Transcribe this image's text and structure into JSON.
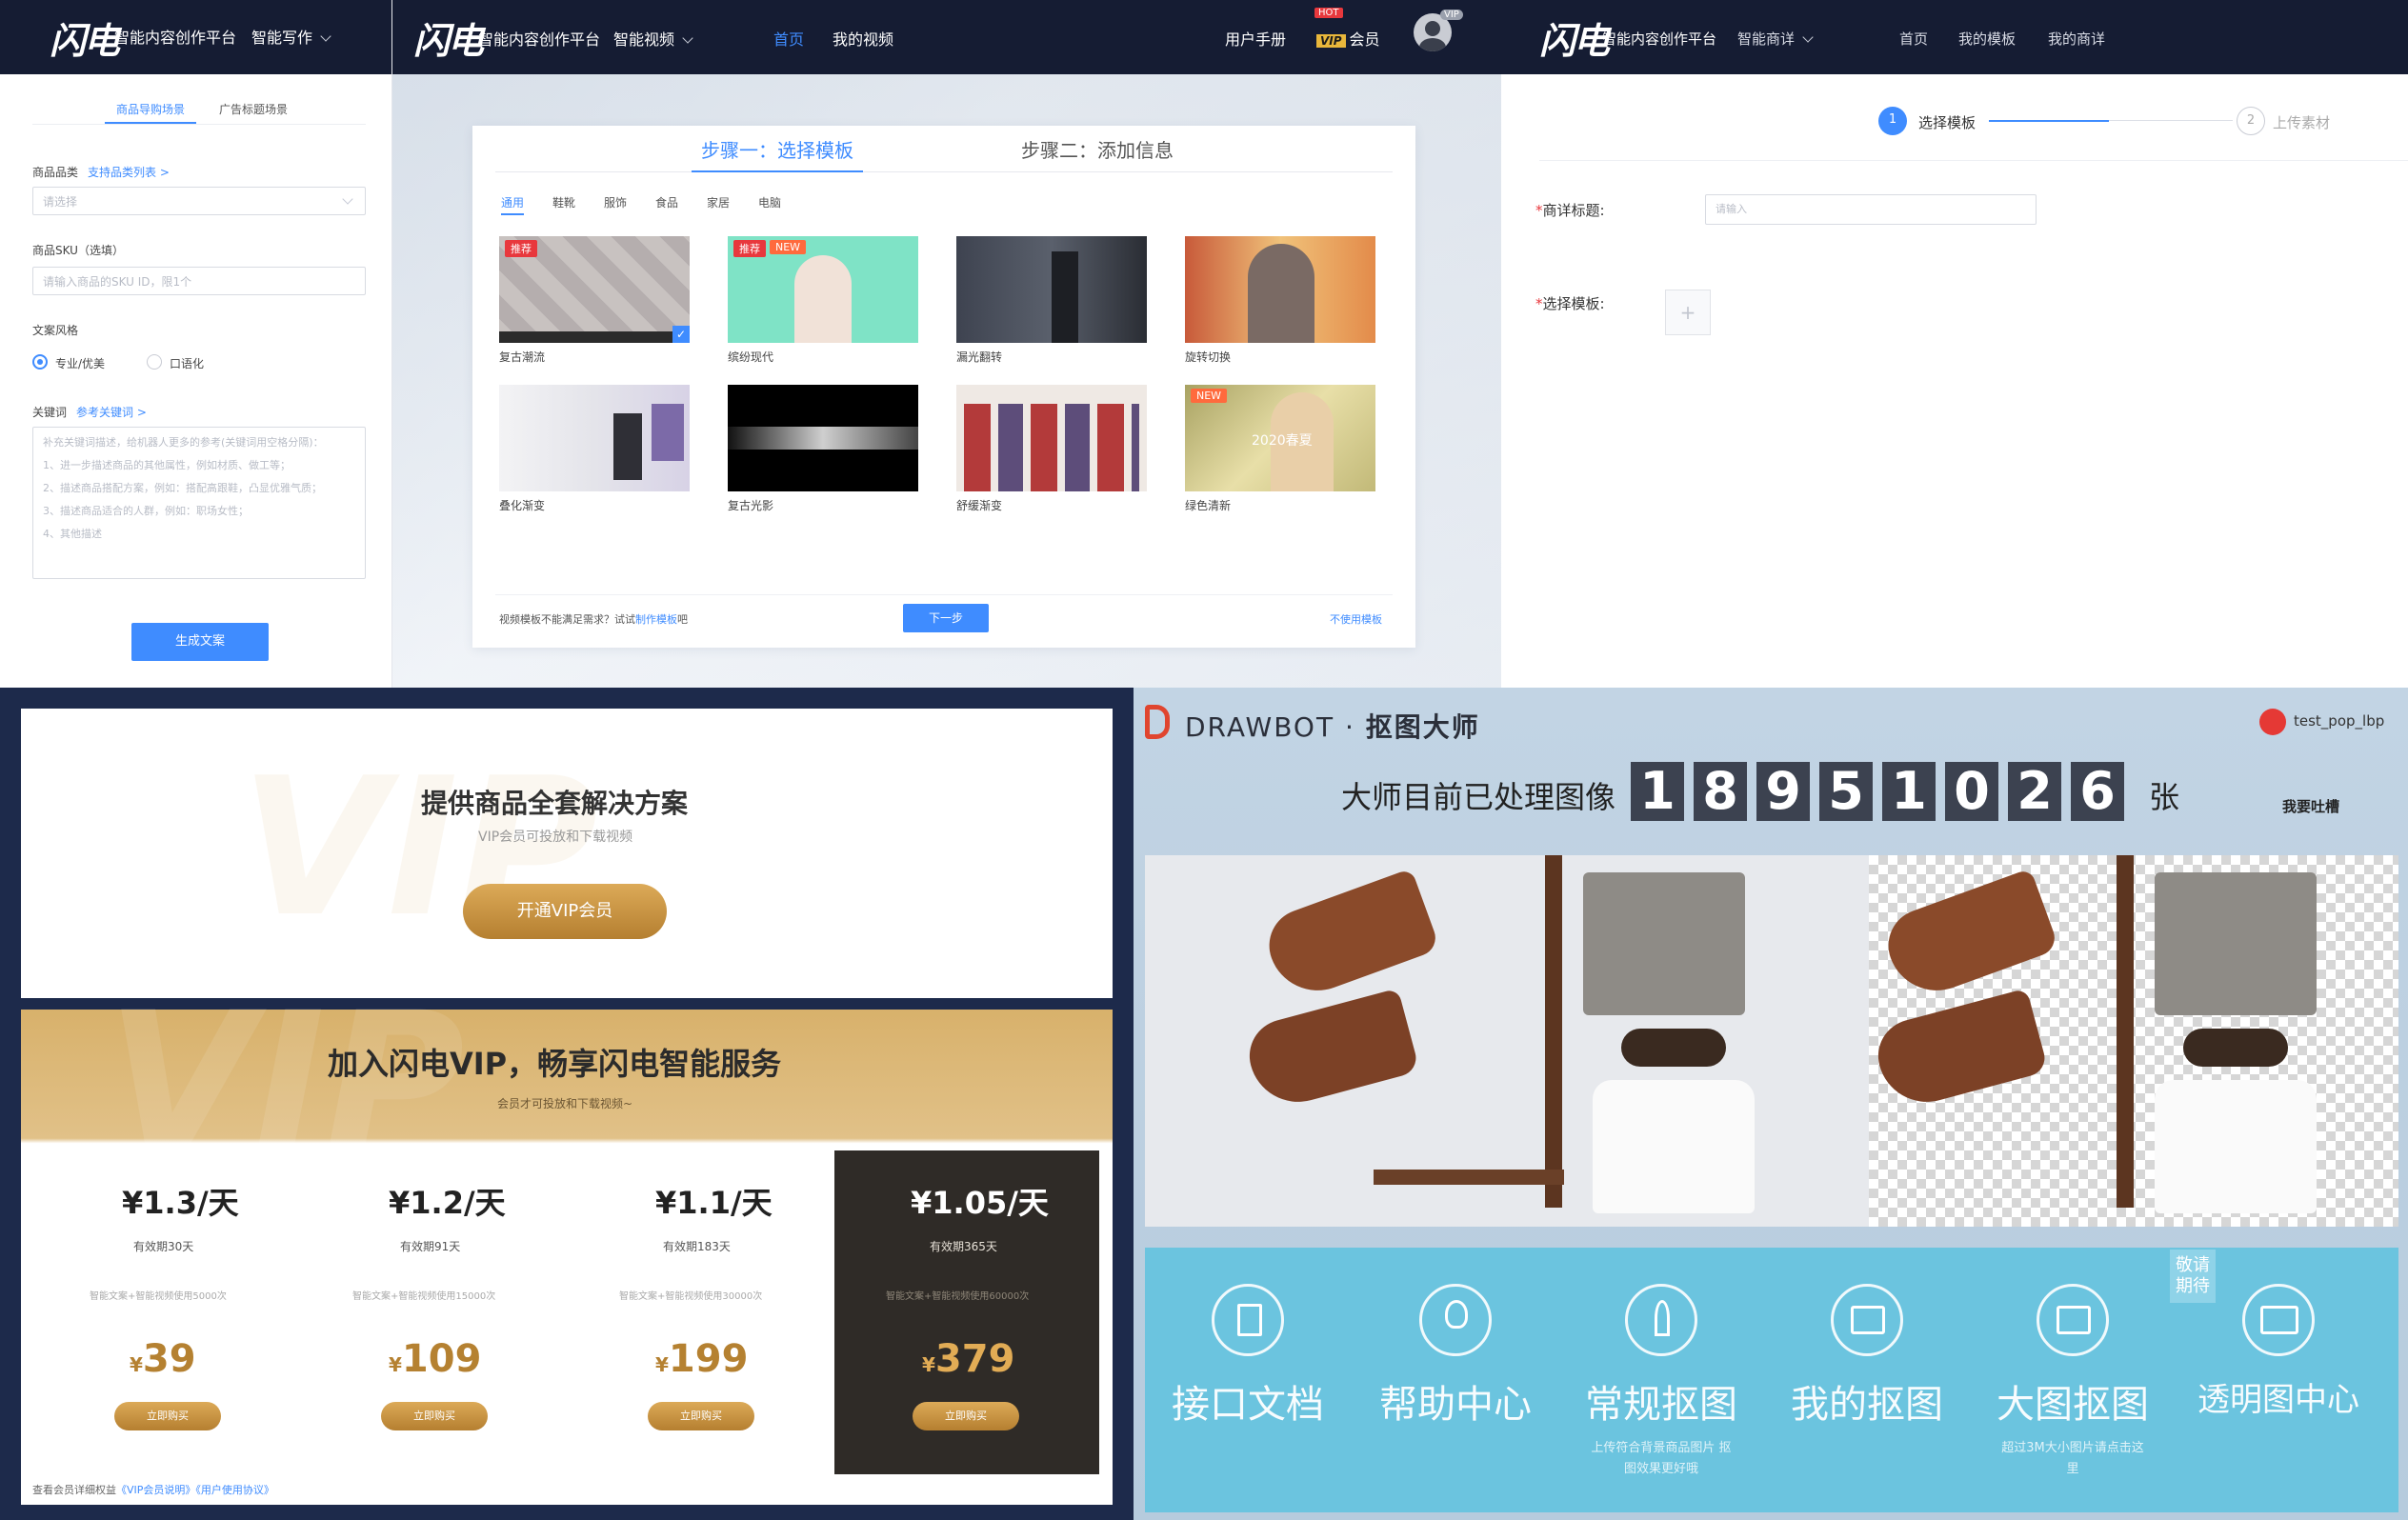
{
  "panel_writing": {
    "nav": {
      "logo": "闪电",
      "platform": "智能内容创作平台",
      "module": "智能写作"
    },
    "tabs": [
      "商品导购场景",
      "广告标题场景"
    ],
    "category": {
      "label": "商品品类",
      "link": "支持品类列表 >",
      "placeholder": "请选择"
    },
    "sku": {
      "label": "商品SKU（选填）",
      "placeholder": "请输入商品的SKU ID，限1个"
    },
    "style": {
      "label": "文案风格",
      "options": [
        "专业/优美",
        "口语化"
      ]
    },
    "keywords": {
      "label": "关键词",
      "link": "参考关键词 >",
      "hint": [
        "补充关键词描述，给机器人更多的参考(关键词用空格分隔)：",
        "1、进一步描述商品的其他属性，例如材质、做工等；",
        "2、描述商品搭配方案，例如：搭配高跟鞋，凸显优雅气质；",
        "3、描述商品适合的人群，例如：职场女性；",
        "4、其他描述"
      ]
    },
    "generate_button": "生成文案"
  },
  "panel_video": {
    "nav": {
      "logo": "闪电",
      "platform": "智能内容创作平台",
      "module": "智能视频",
      "home": "首页",
      "my_videos": "我的视频",
      "manual": "用户手册",
      "hot": "HOT",
      "vip_badge": "VIP",
      "member": "会员",
      "avatar_badge": "VIP"
    },
    "step1": "步骤一：选择模板",
    "step2": "步骤二：添加信息",
    "categories": [
      "通用",
      "鞋靴",
      "服饰",
      "食品",
      "家居",
      "电脑"
    ],
    "templates": [
      {
        "name": "复古潮流",
        "tag": "推荐"
      },
      {
        "name": "缤纷现代",
        "tag": "推荐",
        "tag2": "NEW"
      },
      {
        "name": "漏光翻转"
      },
      {
        "name": "旋转切换"
      },
      {
        "name": "叠化渐变"
      },
      {
        "name": "复古光影"
      },
      {
        "name": "舒缓渐变"
      },
      {
        "name": "绿色清新",
        "tag": "NEW",
        "overlay": "2020春夏"
      }
    ],
    "footer_text": "视频模板不能满足需求？试试",
    "footer_link": "制作模板",
    "footer_suffix": "吧",
    "next_button": "下一步",
    "skip_link": "不使用模板"
  },
  "panel_detail": {
    "nav": {
      "logo": "闪电",
      "platform": "智能内容创作平台",
      "module": "智能商详",
      "links": [
        "首页",
        "我的模板",
        "我的商详"
      ]
    },
    "steps": [
      {
        "num": "1",
        "label": "选择模板"
      },
      {
        "num": "2",
        "label": "上传素材"
      }
    ],
    "title_label": "商详标题:",
    "title_placeholder": "请输入",
    "template_label": "选择模板:",
    "required_mark": "*",
    "plus": "+"
  },
  "panel_vip": {
    "banner_title": "提供商品全套解决方案",
    "banner_sub": "VIP会员可投放和下载视频",
    "open_button": "开通VIP会员",
    "join_title": "加入闪电VIP，畅享闪电智能服务",
    "join_sub": "会员才可投放和下载视频~",
    "watermark": "VIP",
    "plans": [
      {
        "daily": "¥1.3/天",
        "validity": "有效期30天",
        "desc": "智能文案+智能视频使用5000次",
        "price": "39",
        "buy": "立即购买"
      },
      {
        "daily": "¥1.2/天",
        "validity": "有效期91天",
        "desc": "智能文案+智能视频使用15000次",
        "price": "109",
        "buy": "立即购买"
      },
      {
        "daily": "¥1.1/天",
        "validity": "有效期183天",
        "desc": "智能文案+智能视频使用30000次",
        "price": "199",
        "buy": "立即购买"
      },
      {
        "daily": "¥1.05/天",
        "validity": "有效期365天",
        "desc": "智能文案+智能视频使用60000次",
        "price": "379",
        "buy": "立即购买"
      }
    ],
    "currency": "¥",
    "footer": "查看会员详细权益",
    "footer_link1": "《VIP会员说明》",
    "footer_link2": "《用户使用协议》"
  },
  "panel_drawbot": {
    "brand": "DRAWBOT",
    "brand_cn": "抠图大师",
    "user": "test_pop_lbp",
    "counter_prefix": "大师目前已处理图像",
    "digits": [
      "1",
      "8",
      "9",
      "5",
      "1",
      "0",
      "2",
      "6"
    ],
    "counter_suffix": "张",
    "feedback": "我要吐槽",
    "services": [
      {
        "name": "接口文档",
        "sub": ""
      },
      {
        "name": "帮助中心",
        "sub": ""
      },
      {
        "name": "常规抠图",
        "sub": "上传符合背景商品图片 抠图效果更好哦"
      },
      {
        "name": "我的抠图",
        "sub": ""
      },
      {
        "name": "大图抠图",
        "sub": "超过3M大小图片请点击这里"
      },
      {
        "name": "透明图中心",
        "sub": ""
      }
    ],
    "coming_soon": "敬请期待"
  },
  "colors": {
    "nav_bg": "#151c33",
    "primary_blue": "#3f8cff",
    "gold": "#c99a4a",
    "vip_dark": "#2f2b27",
    "drawbot_blue": "#68c3df",
    "drawbot_bg": "#b7cde0"
  }
}
